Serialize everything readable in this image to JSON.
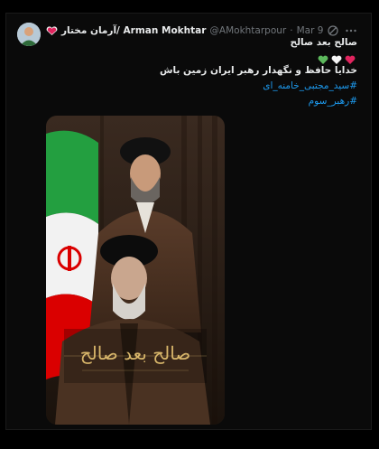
{
  "tweet": {
    "author_name": "آرمان مختار/ Arman Mokhtar",
    "handle": "@AMokhtarpour",
    "separator": "·",
    "date": "Mar 9",
    "line1": "صالح بعد صالح",
    "hearts": [
      "❤️",
      "🤍",
      "💚"
    ],
    "line3": "خدایا حافظ و نگهدار رهبر ایران زمین باش",
    "hashtag1": "#سید_مجتبی_خامنه_ای",
    "hashtag2": "#رهبر_سوم",
    "poster_calligraphy": "صالح بعد صالح",
    "colors": {
      "link": "#1d9bf0",
      "muted": "#71767b",
      "text": "#e7e9ea"
    }
  }
}
